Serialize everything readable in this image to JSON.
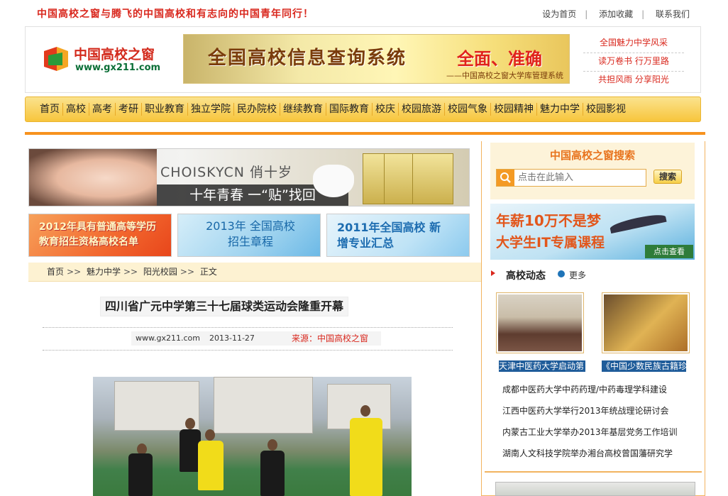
{
  "top": {
    "slogan": "中国高校之窗与腾飞的中国高校和有志向的中国青年同行！",
    "links": [
      "设为首页",
      "添加收藏",
      "联系我们"
    ]
  },
  "header": {
    "logo_name": "中国高校之窗",
    "logo_url": "www.gx211.com",
    "banner_title": "全国高校信息查询系统",
    "banner_slogan": "全面、准确",
    "banner_sub": "——中国高校之窗大学库管理系统",
    "side_links": [
      "全国魅力中学风采",
      "读万卷书 行万里路",
      "共担风雨 分享阳光"
    ]
  },
  "nav": [
    "首页",
    "高校",
    "高考",
    "考研",
    "职业教育",
    "独立学院",
    "民办院校",
    "继续教育",
    "国际教育",
    "校庆",
    "校园旅游",
    "校园气象",
    "校园精神",
    "魅力中学",
    "校园影视"
  ],
  "ads": {
    "choisky_brand": "CHOISKYCN 俏十岁",
    "choisky_slogan": "十年青春 一“贴”找回",
    "promo1": "2012年具有普通高等学历 教育招生资格高校名单",
    "promo2": "2013年 全国高校招生章程",
    "promo3": "2011年全国高校 新增专业汇总"
  },
  "breadcrumb": [
    "首页",
    "魅力中学",
    "阳光校园",
    "正文"
  ],
  "article": {
    "title": "四川省广元中学第三十七届球类运动会隆重开幕",
    "site": "www.gx211.com",
    "date": "2013-11-27",
    "source": "来源：中国高校之窗"
  },
  "sidebar": {
    "search_title": "中国高校之窗搜索",
    "search_placeholder": "点击在此输入",
    "search_button": "搜索",
    "it_ad_line1": "年薪10万不是梦",
    "it_ad_line2": "大学生IT专属课程",
    "it_ad_button": "点击查看",
    "news_title": "高校动态",
    "news_more": "更多",
    "thumb_captions": [
      "天津中医药大学启动第",
      "《中国少数民族古籍珍"
    ],
    "news_items": [
      "成都中医药大学中药药理/中药毒理学科建设",
      "江西中医药大学举行2013年统战理论研讨会",
      "内蒙古工业大学举办2013年基层党务工作培训",
      "湖南人文科技学院举办湘台高校曾国藩研究学"
    ]
  },
  "colors": {
    "accent": "#f7921e",
    "brand_red": "#d9281e",
    "nav_bg": "#f7c53c"
  }
}
